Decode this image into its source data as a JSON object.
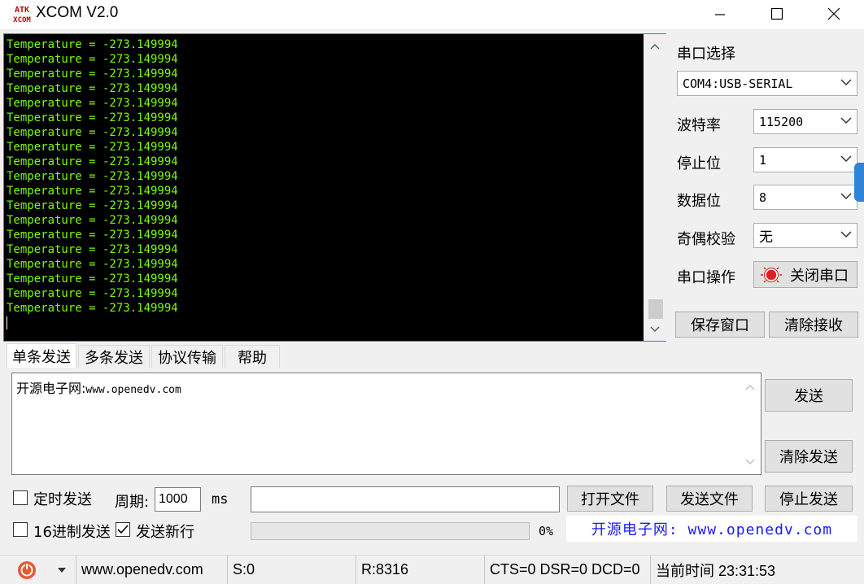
{
  "window": {
    "logo_text": "ATK\nXCOM",
    "title": "XCOM V2.0",
    "minimize_icon": "minimize-icon",
    "maximize_icon": "maximize-icon",
    "close_icon": "close-icon"
  },
  "terminal": {
    "lines": [
      "Temperature = -273.149994",
      "Temperature = -273.149994",
      "Temperature = -273.149994",
      "Temperature = -273.149994",
      "Temperature = -273.149994",
      "Temperature = -273.149994",
      "Temperature = -273.149994",
      "Temperature = -273.149994",
      "Temperature = -273.149994",
      "Temperature = -273.149994",
      "Temperature = -273.149994",
      "Temperature = -273.149994",
      "Temperature = -273.149994",
      "Temperature = -273.149994",
      "Temperature = -273.149994",
      "Temperature = -273.149994",
      "Temperature = -273.149994",
      "Temperature = -273.149994",
      "Temperature = -273.149994"
    ],
    "text_color": "#7cfc00",
    "background": "#000000"
  },
  "settings": {
    "port_label": "串口选择",
    "port_value": "COM4:USB-SERIAL",
    "baud_label": "波特率",
    "baud_value": "115200",
    "stop_label": "停止位",
    "stop_value": "1",
    "data_label": "数据位",
    "data_value": "8",
    "parity_label": "奇偶校验",
    "parity_value": "无",
    "op_label": "串口操作",
    "op_button": "关闭串口",
    "save_window": "保存窗口",
    "clear_receive": "清除接收"
  },
  "tabs": [
    {
      "label": "单条发送",
      "active": true
    },
    {
      "label": "多条发送",
      "active": false
    },
    {
      "label": "协议传输",
      "active": false
    },
    {
      "label": "帮助",
      "active": false
    }
  ],
  "send": {
    "text_prefix": "开源电子网:",
    "text_url": "www.openedv.com",
    "send_button": "发送",
    "clear_send_button": "清除发送"
  },
  "options": {
    "timed_send": "定时发送",
    "timed_checked": false,
    "period_label": "周期:",
    "period_value": "1000",
    "period_unit": "ms",
    "open_file": "打开文件",
    "send_file": "发送文件",
    "stop_send": "停止发送",
    "hex_send": "16进制发送",
    "hex_checked": false,
    "newline": "发送新行",
    "newline_checked": true,
    "progress_percent": "0%",
    "progress_value": 0,
    "banner": "开源电子网: www.openedv.com"
  },
  "status": {
    "site": "www.openedv.com",
    "sent": "S:0",
    "received": "R:8316",
    "lines": "CTS=0 DSR=0 DCD=0",
    "time": "当前时间 23:31:53"
  },
  "colors": {
    "accent": "#2f84d8",
    "banner_text": "#1a1aff",
    "port_icon_red": "#e02020"
  }
}
